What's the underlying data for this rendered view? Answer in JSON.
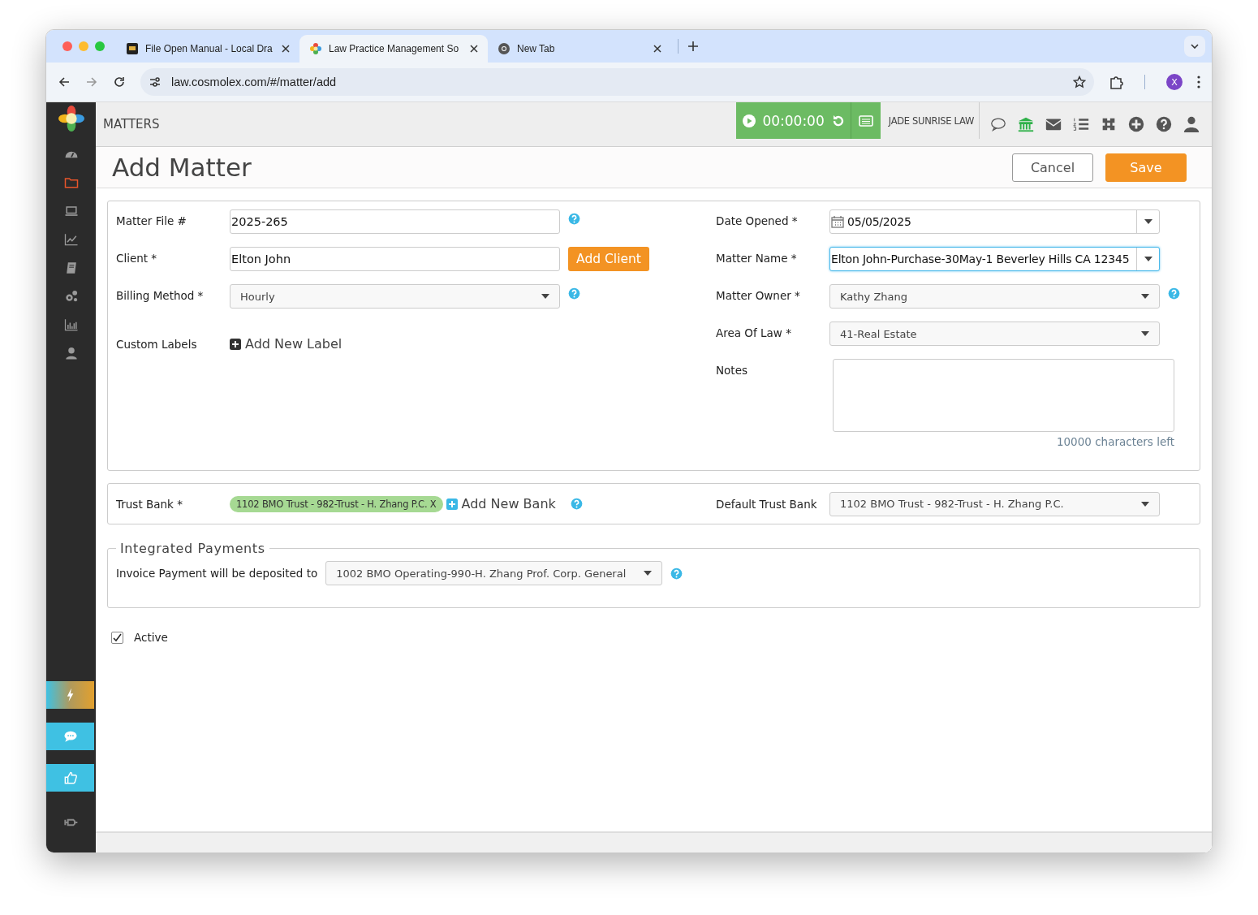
{
  "browser": {
    "tabs": [
      {
        "title": "File Open Manual - Local Dra",
        "kind": "doc",
        "selected": false
      },
      {
        "title": "Law Practice Management So",
        "kind": "flower",
        "selected": true
      },
      {
        "title": "New Tab",
        "kind": "chrome",
        "selected": false
      }
    ],
    "url": "law.cosmolex.com/#/matter/add",
    "profile": "X"
  },
  "sidebar": {
    "items": [
      {
        "kind": "dashboard",
        "selected": false
      },
      {
        "kind": "folder",
        "selected": true
      },
      {
        "kind": "laptop",
        "selected": false
      },
      {
        "kind": "chart",
        "selected": false
      },
      {
        "kind": "book",
        "selected": false
      },
      {
        "kind": "gears",
        "selected": false
      },
      {
        "kind": "bars",
        "selected": false
      },
      {
        "kind": "user",
        "selected": false
      }
    ],
    "actions": [
      {
        "kind": "flash"
      },
      {
        "kind": "chat"
      },
      {
        "kind": "thumbs"
      },
      {
        "kind": "pin"
      }
    ]
  },
  "header": {
    "section": "MATTERS",
    "timer": "00:00:00",
    "firm": "JADE SUNRISE LAW",
    "tools": [
      {
        "kind": "chat"
      },
      {
        "kind": "bank"
      },
      {
        "kind": "mail"
      },
      {
        "kind": "list"
      },
      {
        "kind": "puzzle"
      },
      {
        "kind": "plus"
      },
      {
        "kind": "help"
      },
      {
        "kind": "user"
      }
    ]
  },
  "page": {
    "title": "Add Matter",
    "buttons": [
      {
        "label": "Cancel",
        "kind": "secondary"
      },
      {
        "label": "Save",
        "kind": "primary"
      }
    ]
  },
  "details": {
    "left": [
      {
        "label": "Matter File #",
        "kind": "text",
        "value": "2025-265",
        "help": true
      },
      {
        "label": "Client *",
        "kind": "text",
        "value": "Elton John",
        "action": "Add Client"
      },
      {
        "label": "Billing Method *",
        "kind": "select",
        "value": "Hourly",
        "help": true
      },
      {
        "label": "Custom Labels",
        "kind": "link",
        "value": "Add New Label"
      }
    ],
    "right": [
      {
        "label": "Date Opened *",
        "kind": "date",
        "value": "05/05/2025"
      },
      {
        "label": "Matter Name *",
        "kind": "combo",
        "value": "Elton John-Purchase-30May-1 Beverley Hills CA 12345",
        "focused": true
      },
      {
        "label": "Matter Owner *",
        "kind": "select",
        "value": "Kathy Zhang",
        "help": true
      },
      {
        "label": "Area Of Law *",
        "kind": "select",
        "value": "41-Real Estate"
      },
      {
        "label": "Notes",
        "kind": "textarea",
        "hint": "10000 characters left"
      }
    ]
  },
  "trust": {
    "label": "Trust Bank *",
    "tags": [
      {
        "text": "1102 BMO Trust - 982-Trust - H. Zhang P.C. X"
      }
    ],
    "add_link": "Add New Bank",
    "help": true,
    "default_label": "Default Trust Bank",
    "default_value": "1102 BMO Trust - 982-Trust - H. Zhang P.C."
  },
  "integrated": {
    "legend": "Integrated Payments",
    "label": "Invoice Payment will be deposited to",
    "value": "1002 BMO Operating-990-H. Zhang Prof. Corp. General",
    "help": true
  },
  "active": {
    "label": "Active",
    "checked": true
  }
}
